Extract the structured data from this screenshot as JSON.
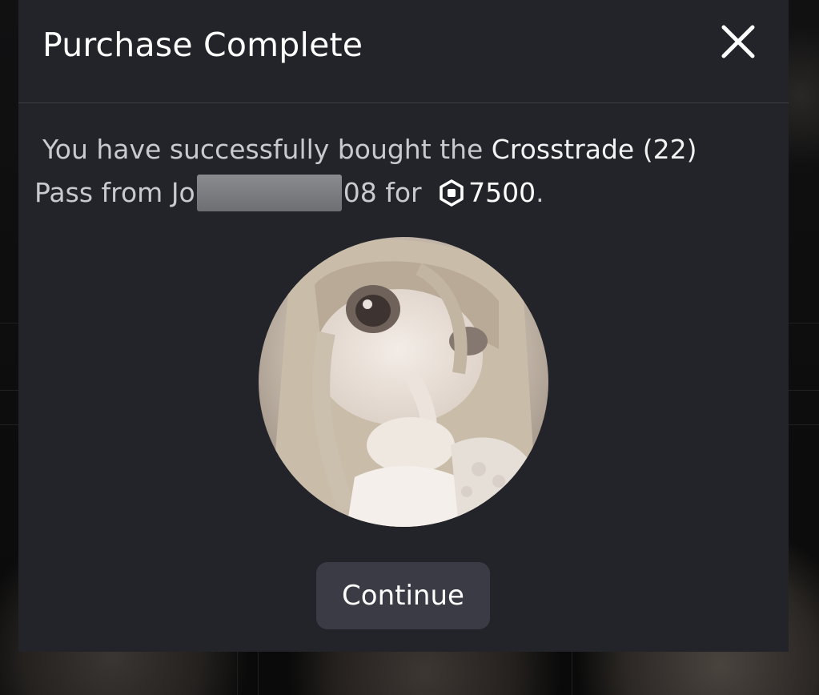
{
  "dialog": {
    "title": "Purchase Complete",
    "close_icon": "close-icon",
    "message": {
      "prefix": "You have successfully bought the ",
      "item_name": "Crosstrade (22)",
      "pass_from": " Pass from ",
      "seller_visible_start": "Jo",
      "seller_visible_end": "08",
      "for_text": " for ",
      "currency_icon": "robux-icon",
      "price": "7500",
      "suffix": "."
    },
    "item_image": "item-thumbnail-doll",
    "continue_label": "Continue"
  },
  "colors": {
    "modal_bg": "#232429",
    "button_bg": "#3a3b44",
    "text_primary": "#ffffff",
    "text_secondary": "#c9cacd"
  }
}
